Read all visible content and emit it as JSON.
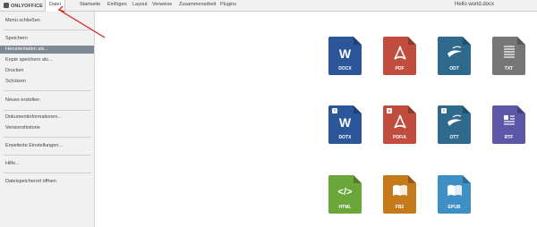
{
  "header": {
    "logo": "ONLYOFFICE",
    "tabs": [
      {
        "label": "Datei",
        "active": true
      },
      {
        "label": "Startseite",
        "active": false
      },
      {
        "label": "Einfügen",
        "active": false
      },
      {
        "label": "Layout",
        "active": false
      },
      {
        "label": "Verweise",
        "active": false
      },
      {
        "label": "Zusammenarbeit",
        "active": false
      },
      {
        "label": "Plugins",
        "active": false
      }
    ],
    "document_title": "Hello world.docx"
  },
  "sidebar": {
    "close": "Menü schließen",
    "items": [
      {
        "label": "Speichern"
      },
      {
        "label": "Herunterladen als...",
        "selected": true
      },
      {
        "label": "Kopie speichern als..."
      },
      {
        "label": "Drucken"
      },
      {
        "label": "Schützen"
      },
      {
        "label": "Neues erstellen"
      },
      {
        "label": "Dokumentinformationen..."
      },
      {
        "label": "Versionshistorie"
      },
      {
        "label": "Erweiterte Einstellungen..."
      },
      {
        "label": "Hilfe..."
      },
      {
        "label": "Dateispeicherort öffnen"
      }
    ]
  },
  "formats": [
    {
      "label": "DOCX",
      "color": "#2b579a",
      "icon": "word-icon",
      "template": false
    },
    {
      "label": "PDF",
      "color": "#c14d3f",
      "icon": "pdf-icon",
      "template": false
    },
    {
      "label": "ODT",
      "color": "#2f6a8c",
      "icon": "odt-icon",
      "template": false
    },
    {
      "label": "TXT",
      "color": "#767676",
      "icon": "text-lines-icon",
      "template": false
    },
    {
      "label": "DOTX",
      "color": "#2b579a",
      "icon": "word-icon",
      "template": true
    },
    {
      "label": "PDF/A",
      "color": "#c14d3f",
      "icon": "pdf-icon",
      "template": true
    },
    {
      "label": "OTT",
      "color": "#2f6a8c",
      "icon": "odt-icon",
      "template": true
    },
    {
      "label": "RTF",
      "color": "#5c57a6",
      "icon": "rich-text-icon",
      "template": false
    },
    {
      "label": "HTML",
      "color": "#6aa63a",
      "icon": "code-icon",
      "template": false
    },
    {
      "label": "FB2",
      "color": "#c57a1c",
      "icon": "book-icon",
      "template": false
    },
    {
      "label": "EPUB",
      "color": "#3d8fc4",
      "icon": "book-icon",
      "template": false
    }
  ],
  "annotation": {
    "color": "#e02020"
  }
}
